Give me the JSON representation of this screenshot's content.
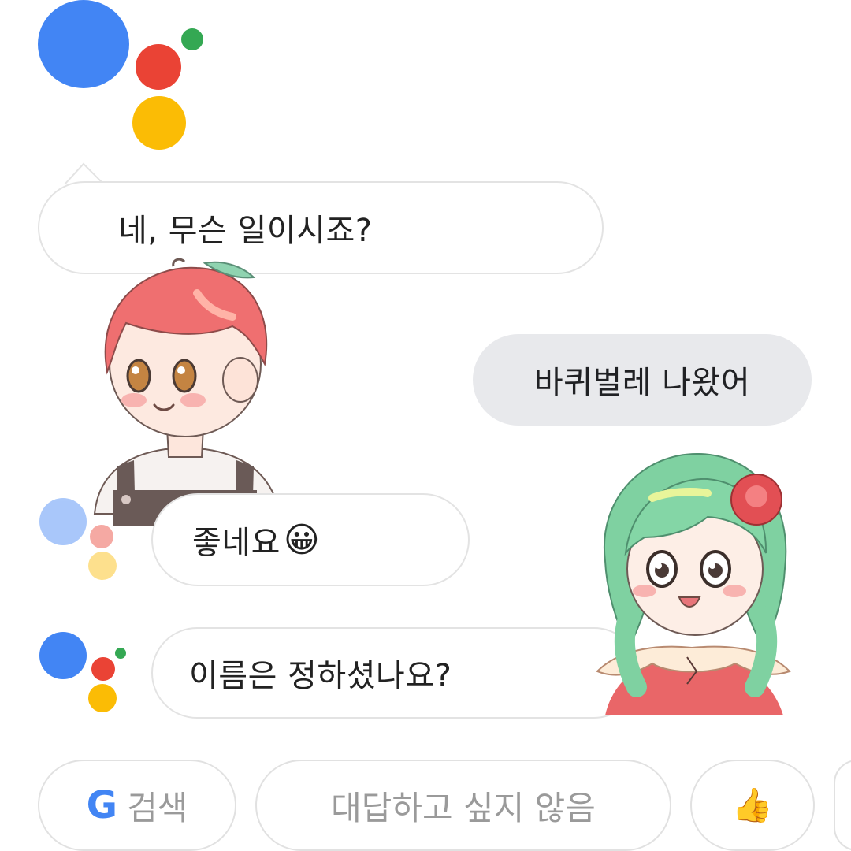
{
  "colors": {
    "assistant_blue": "#4285F4",
    "assistant_red": "#EA4335",
    "assistant_yellow": "#FBBC05",
    "assistant_green": "#34A853",
    "user_bubble": "#E8E9EC"
  },
  "messages": [
    {
      "role": "assistant",
      "text": "네, 무슨 일이시죠?"
    },
    {
      "role": "user",
      "text": "바퀴벌레 나왔어"
    },
    {
      "role": "assistant",
      "text": "좋네요",
      "emoji": "😀"
    },
    {
      "role": "assistant",
      "text": "이름은 정하셨나요?"
    }
  ],
  "suggestions": [
    {
      "label": "검색",
      "icon": "google-g-icon"
    },
    {
      "label": "대답하고 싶지 않음"
    },
    {
      "icon": "thumbs-up-icon",
      "glyph": "👍"
    }
  ],
  "icons": {
    "google_g": "G"
  }
}
